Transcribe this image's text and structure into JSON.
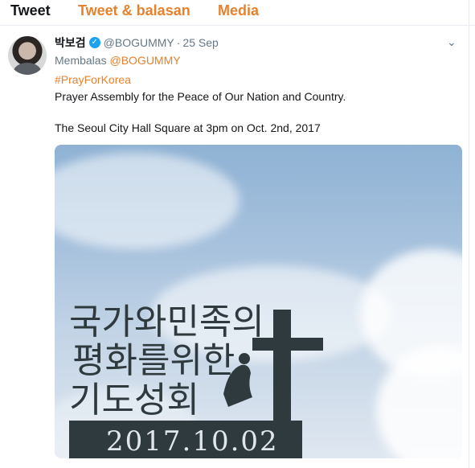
{
  "tabs": [
    {
      "label": "Tweet",
      "active": true
    },
    {
      "label": "Tweet & balasan",
      "active": false
    },
    {
      "label": "Media",
      "active": false
    }
  ],
  "tweet": {
    "display_name": "박보검",
    "verified_icon": "✓",
    "handle": "@BOGUMMY",
    "separator": "·",
    "date": "25 Sep",
    "caret_icon": "⌄",
    "reply_prefix": "Membalas",
    "reply_mention": "@BOGUMMY",
    "hashtag": "#PrayForKorea",
    "line1": "Prayer Assembly for the Peace of Our Nation and Country.",
    "line2": "The Seoul City Hall Square at 3pm on Oct. 2nd, 2017"
  },
  "media": {
    "sign_lines": [
      "국가와민족의",
      "평화를위한",
      "기도성회"
    ],
    "sign_date": "2017.10.02"
  },
  "colors": {
    "accent": "#e8812c",
    "verified": "#1da1f2",
    "muted": "#657786",
    "sign": "#2f3a3f"
  }
}
